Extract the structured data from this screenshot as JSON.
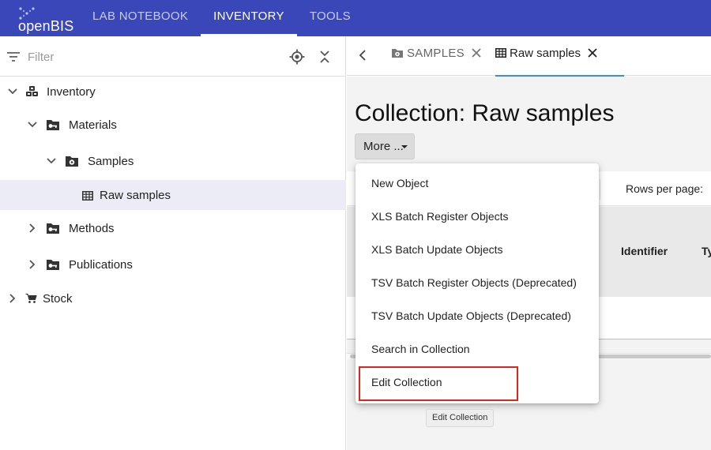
{
  "app": {
    "logo_text": "openBIS",
    "brand_color": "#3a47b8"
  },
  "nav": {
    "items": [
      {
        "label": "LAB NOTEBOOK",
        "active": false
      },
      {
        "label": "INVENTORY",
        "active": true
      },
      {
        "label": "TOOLS",
        "active": false
      }
    ]
  },
  "sidebar": {
    "filter_placeholder": "Filter",
    "tree": [
      {
        "label": "Inventory",
        "icon": "inventory-icon",
        "expanded": true
      },
      {
        "label": "Materials",
        "icon": "folder-key-icon",
        "expanded": true
      },
      {
        "label": "Samples",
        "icon": "folder-gear-icon",
        "expanded": true
      },
      {
        "label": "Raw samples",
        "icon": "table-icon",
        "selected": true
      },
      {
        "label": "Methods",
        "icon": "folder-key-icon",
        "expanded": false
      },
      {
        "label": "Publications",
        "icon": "folder-key-icon",
        "expanded": false
      },
      {
        "label": "Stock",
        "icon": "cart-icon",
        "expanded": false
      }
    ]
  },
  "tabs": [
    {
      "label": "SAMPLES",
      "icon": "folder-gear-icon"
    },
    {
      "label": "Raw samples",
      "icon": "table-icon",
      "active": true
    }
  ],
  "main": {
    "title": "Collection: Raw samples",
    "more_button": "More ...",
    "rows_per_page_label": "Rows per page:",
    "columns": [
      "Identifier",
      "Ty"
    ]
  },
  "menu": {
    "items": [
      "New Object",
      "XLS Batch Register Objects",
      "XLS Batch Update Objects",
      "TSV Batch Register Objects (Deprecated)",
      "TSV Batch Update Objects (Deprecated)",
      "Search in Collection",
      "Edit Collection"
    ],
    "highlighted_item": "Edit Collection",
    "highlight_color": "#e2231a"
  },
  "tooltip": "Edit Collection"
}
